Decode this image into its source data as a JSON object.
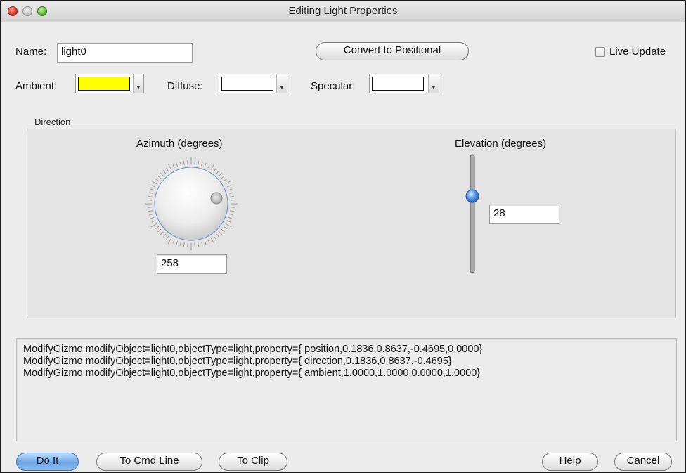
{
  "window": {
    "title": "Editing Light Properties"
  },
  "name_row": {
    "name_label": "Name:",
    "name_value": "light0",
    "convert_button": "Convert to Positional",
    "live_update_label": "Live Update",
    "live_update_checked": false
  },
  "colors": {
    "ambient_label": "Ambient:",
    "ambient_color": "#ffff00",
    "diffuse_label": "Diffuse:",
    "diffuse_color": "#ffffff",
    "specular_label": "Specular:",
    "specular_color": "#ffffff"
  },
  "direction": {
    "group_title": "Direction",
    "azimuth_label": "Azimuth (degrees)",
    "azimuth_value": "258",
    "elevation_label": "Elevation (degrees)",
    "elevation_value": "28"
  },
  "console": {
    "lines": [
      "ModifyGizmo modifyObject=light0,objectType=light,property={ position,0.1836,0.8637,-0.4695,0.0000}",
      "ModifyGizmo modifyObject=light0,objectType=light,property={ direction,0.1836,0.8637,-0.4695}",
      "ModifyGizmo modifyObject=light0,objectType=light,property={ ambient,1.0000,1.0000,0.0000,1.0000}"
    ]
  },
  "buttons": {
    "do_it": "Do It",
    "to_cmd_line": "To Cmd Line",
    "to_clip": "To Clip",
    "help": "Help",
    "cancel": "Cancel"
  }
}
